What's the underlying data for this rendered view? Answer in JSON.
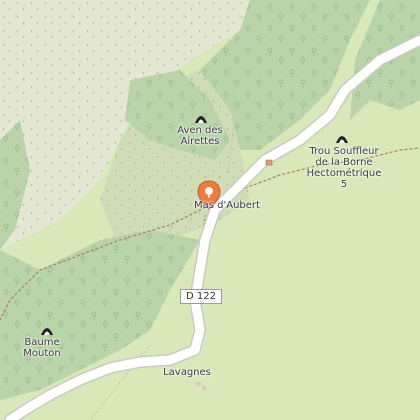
{
  "map": {
    "colors": {
      "forest": "#b8d4a8",
      "meadow": "#d8e8b8",
      "scrub": "#cfdcb8",
      "bare": "#e4e7d3",
      "road": "#ffffff",
      "road_casing": "#c9c9c9",
      "track": "#a8805a",
      "pin": "#f07c3a"
    },
    "markers": {
      "selected_place_icon": "map-pin-icon",
      "cave_icon": "cave-entrance-icon"
    },
    "road": {
      "ref": "D 122"
    },
    "places": [
      {
        "name": "Aven des\nAirettes",
        "type": "cave"
      },
      {
        "name": "Trou Souffleur\nde la Borne\nHectométrique\n5",
        "type": "cave"
      },
      {
        "name": "Mas d'Aubert",
        "type": "hamlet"
      },
      {
        "name": "Baume\nMouton",
        "type": "cave"
      },
      {
        "name": "Lavagnes",
        "type": "hamlet"
      }
    ]
  }
}
